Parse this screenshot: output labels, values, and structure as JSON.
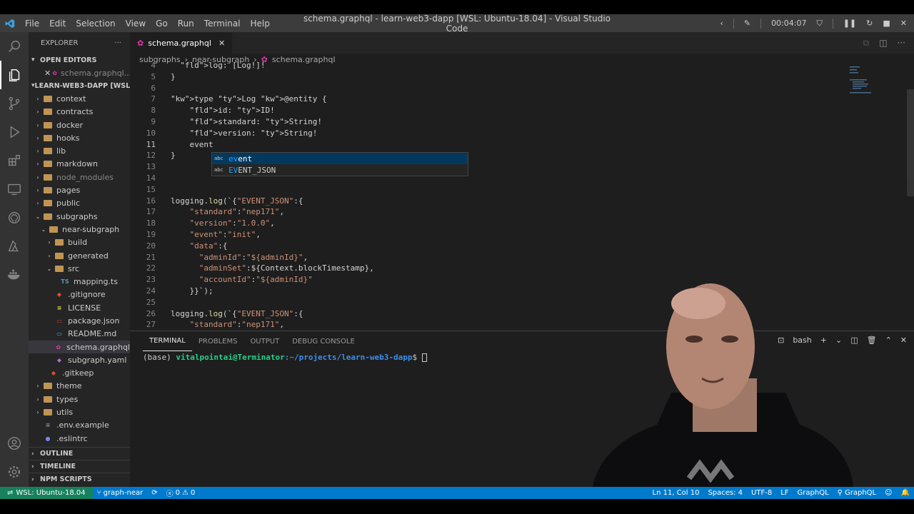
{
  "window": {
    "title": "schema.graphql - learn-web3-dapp [WSL: Ubuntu-18.04] - Visual Studio Code",
    "menu": [
      "File",
      "Edit",
      "Selection",
      "View",
      "Go",
      "Run",
      "Terminal",
      "Help"
    ],
    "recorder_time": "00:04:07"
  },
  "sidebar": {
    "title": "EXPLORER",
    "open_editors_label": "OPEN EDITORS",
    "open_editor_file": "schema.graphql...",
    "workspace_label": "LEARN-WEB3-DAPP [WSL: ...",
    "tree": [
      {
        "label": "context",
        "depth": 1,
        "type": "folder",
        "expanded": false
      },
      {
        "label": "contracts",
        "depth": 1,
        "type": "folder",
        "expanded": false
      },
      {
        "label": "docker",
        "depth": 1,
        "type": "folder",
        "expanded": false
      },
      {
        "label": "hooks",
        "depth": 1,
        "type": "folder",
        "expanded": false
      },
      {
        "label": "lib",
        "depth": 1,
        "type": "folder",
        "expanded": false
      },
      {
        "label": "markdown",
        "depth": 1,
        "type": "folder",
        "expanded": false
      },
      {
        "label": "node_modules",
        "depth": 1,
        "type": "folder",
        "expanded": false,
        "dim": true
      },
      {
        "label": "pages",
        "depth": 1,
        "type": "folder",
        "expanded": false
      },
      {
        "label": "public",
        "depth": 1,
        "type": "folder",
        "expanded": false
      },
      {
        "label": "subgraphs",
        "depth": 1,
        "type": "folder",
        "expanded": true
      },
      {
        "label": "near-subgraph",
        "depth": 2,
        "type": "folder",
        "expanded": true
      },
      {
        "label": "build",
        "depth": 3,
        "type": "folder",
        "expanded": false
      },
      {
        "label": "generated",
        "depth": 3,
        "type": "folder",
        "expanded": false
      },
      {
        "label": "src",
        "depth": 3,
        "type": "folder",
        "expanded": true
      },
      {
        "label": "mapping.ts",
        "depth": 4,
        "type": "ts"
      },
      {
        "label": ".gitignore",
        "depth": 3,
        "type": "git"
      },
      {
        "label": "LICENSE",
        "depth": 3,
        "type": "license"
      },
      {
        "label": "package.json",
        "depth": 3,
        "type": "npm"
      },
      {
        "label": "README.md",
        "depth": 3,
        "type": "md"
      },
      {
        "label": "schema.graphql",
        "depth": 3,
        "type": "graphql",
        "selected": true
      },
      {
        "label": "subgraph.yaml",
        "depth": 3,
        "type": "yaml"
      },
      {
        "label": ".gitkeep",
        "depth": 2,
        "type": "git"
      },
      {
        "label": "theme",
        "depth": 1,
        "type": "folder",
        "expanded": false
      },
      {
        "label": "types",
        "depth": 1,
        "type": "folder",
        "expanded": false
      },
      {
        "label": "utils",
        "depth": 1,
        "type": "folder",
        "expanded": false
      },
      {
        "label": ".env.example",
        "depth": 1,
        "type": "env"
      },
      {
        "label": ".eslintrc",
        "depth": 1,
        "type": "eslint"
      }
    ],
    "outline_label": "OUTLINE",
    "timeline_label": "TIMELINE",
    "npm_scripts_label": "NPM SCRIPTS"
  },
  "editor": {
    "tab_label": "schema.graphql",
    "breadcrumb": [
      "subgraphs",
      "near-subgraph",
      "schema.graphql"
    ],
    "line_numbers": [
      "4",
      "5",
      "6",
      "7",
      "8",
      "9",
      "10",
      "11",
      "12",
      "13",
      "14",
      "15",
      "16",
      "17",
      "18",
      "19",
      "20",
      "21",
      "22",
      "23",
      "24",
      "25",
      "26",
      "27"
    ],
    "current_line": "11",
    "suggestions": [
      {
        "match": "ev",
        "rest": "ent",
        "label": "event"
      },
      {
        "match": "EV",
        "rest": "ENT_JSON",
        "label": "EVENT_JSON"
      }
    ],
    "code_lines": [
      "  log: [Log!]!",
      "}",
      "",
      "type Log @entity {",
      "    id: ID!",
      "    standard: String!",
      "    version: String!",
      "    event",
      "}",
      "",
      "",
      "",
      "logging.log(`{\"EVENT_JSON\":{",
      "    \"standard\":\"nep171\",",
      "    \"version\":\"1.0.0\",",
      "    \"event\":\"init\",",
      "    \"data\":{",
      "      \"adminId\":\"${adminId}\",",
      "      \"adminSet\":${Context.blockTimestamp},",
      "      \"accountId\":\"${adminId}\"",
      "    }}`);",
      "",
      "logging.log(`{\"EVENT_JSON\":{",
      "    \"standard\":\"nep171\","
    ]
  },
  "panel": {
    "tabs": [
      "TERMINAL",
      "PROBLEMS",
      "OUTPUT",
      "DEBUG CONSOLE"
    ],
    "shell": "bash",
    "prompt_env": "(base)",
    "prompt_user": "vitalpointai@Terminator",
    "prompt_path": ":~/projects/learn-web3-dapp",
    "prompt_end": "$"
  },
  "statusbar": {
    "remote": "WSL: Ubuntu-18.04",
    "branch": "graph-near",
    "errors": "0",
    "warnings": "0",
    "position": "Ln 11, Col 10",
    "spaces": "Spaces: 4",
    "encoding": "UTF-8",
    "eol": "LF",
    "language": "GraphQL",
    "language2": "GraphQL"
  },
  "colors": {
    "accent": "#007acc",
    "remote": "#16825d",
    "editor_bg": "#1e1e1e",
    "sidebar_bg": "#252526"
  }
}
